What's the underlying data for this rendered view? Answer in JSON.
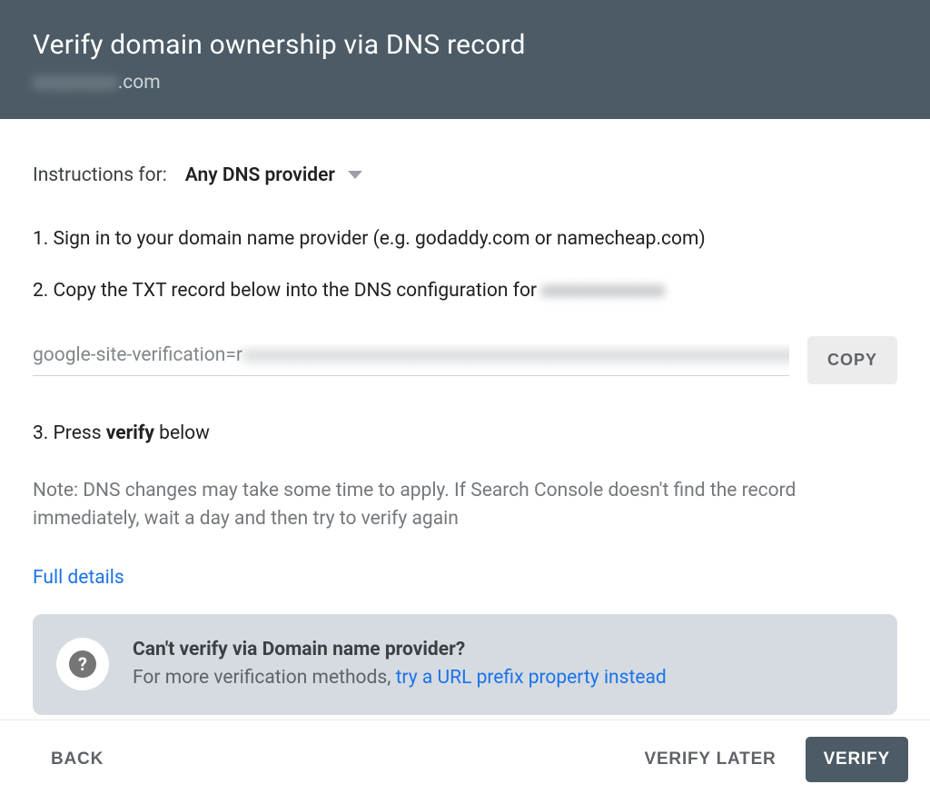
{
  "header": {
    "title": "Verify domain ownership via DNS record",
    "domain_blurred": "xxxxxxxxx",
    "domain_suffix": ".com"
  },
  "instructions": {
    "label": "Instructions for:",
    "provider_selected": "Any DNS provider"
  },
  "steps": {
    "s1": "1. Sign in to your domain name provider (e.g. godaddy.com or namecheap.com)",
    "s2_prefix": "2. Copy the TXT record below into the DNS configuration for ",
    "s2_blurred": "xxxxxxxxxxxxx",
    "s3_prefix": "3. Press ",
    "s3_bold": "verify",
    "s3_suffix": " below"
  },
  "txt_record": {
    "prefix": "google-site-verification=r",
    "blurred": "xxxxxxxxxxxxxxxxxxxxxxxxxxxxxxxxxxxxxxxxxxxxxxxxxxxxxxxxxxxx",
    "copy_label": "COPY"
  },
  "note": "Note: DNS changes may take some time to apply. If Search Console doesn't find the record immediately, wait a day and then try to verify again",
  "details_link": "Full details",
  "help": {
    "heading": "Can't verify via Domain name provider?",
    "sub_prefix": "For more verification methods, ",
    "link": "try a URL prefix property instead"
  },
  "footer": {
    "back": "BACK",
    "verify_later": "VERIFY LATER",
    "verify": "VERIFY"
  },
  "colors": {
    "header_bg": "#4c5b66",
    "link": "#1a73e8",
    "muted": "#5f6368"
  }
}
